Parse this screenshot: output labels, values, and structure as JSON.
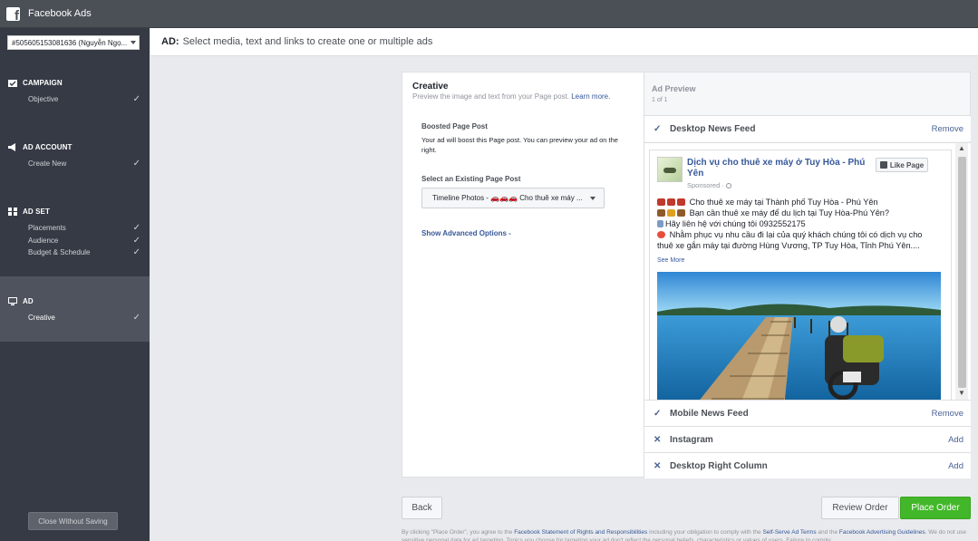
{
  "app": {
    "title": "Facebook Ads"
  },
  "sidebar": {
    "account_label": "#505605153081636 (Nguyễn Ngọ...",
    "sections": [
      {
        "title": "CAMPAIGN",
        "items": [
          {
            "label": "Objective"
          }
        ]
      },
      {
        "title": "AD ACCOUNT",
        "items": [
          {
            "label": "Create New"
          }
        ]
      },
      {
        "title": "AD SET",
        "items": [
          {
            "label": "Placements"
          },
          {
            "label": "Audience"
          },
          {
            "label": "Budget & Schedule"
          }
        ]
      },
      {
        "title": "AD",
        "items": [
          {
            "label": "Creative"
          }
        ]
      }
    ],
    "close_label": "Close Without Saving"
  },
  "header": {
    "prefix": "AD:",
    "text": "Select media, text and links to create one or multiple ads"
  },
  "creative": {
    "title": "Creative",
    "subtitle": "Preview the image and text from your Page post.",
    "learn_more": "Learn more.",
    "boosted_label": "Boosted Page Post",
    "boosted_desc": "Your ad will boost this Page post. You can preview your ad on the right.",
    "select_label": "Select an Existing Page Post",
    "select_value": "Timeline Photos - 🚗🚗🚗 Cho thuê xe máy ...",
    "advanced_link": "Show Advanced Options -"
  },
  "preview": {
    "title": "Ad Preview",
    "count": "1 of 1",
    "placements": [
      {
        "label": "Desktop News Feed",
        "action": "Remove",
        "selected": true
      },
      {
        "label": "Mobile News Feed",
        "action": "Remove",
        "selected": true
      },
      {
        "label": "Instagram",
        "action": "Add",
        "selected": false
      },
      {
        "label": "Desktop Right Column",
        "action": "Add",
        "selected": false
      }
    ],
    "post": {
      "page_name": "Dịch vụ cho thuê xe máy ở Tuy Hòa - Phú Yên",
      "sponsored": "Sponsored · ",
      "like_label": "Like Page",
      "lines": [
        "Cho thuê xe máy tại Thành phố Tuy Hòa - Phú Yên",
        "Bạn cần thuê xe máy để du lịch tại Tuy Hòa-Phú Yên?",
        "Hãy liên hệ với chúng tôi 0932552175",
        "Nhằm phục vụ nhu cầu đi lại của quý khách chúng tôi có dịch vụ cho",
        "thuê xe gắn máy tại đường Hùng Vương, TP Tuy Hòa, Tỉnh Phú Yên...."
      ],
      "see_more": "See More"
    }
  },
  "buttons": {
    "back": "Back",
    "review": "Review Order",
    "place": "Place Order"
  },
  "footer": {
    "t1": "By clicking \"Place Order\", you agree to the ",
    "l1": "Facebook Statement of Rights and Responsibilities",
    "t2": " including your obligation to comply with the ",
    "l2": "Self-Serve Ad Terms",
    "t3": " and the ",
    "l3": "Facebook Advertising Guidelines",
    "t4": ". We do not use sensitive personal data for ad targeting. Topics you choose for targeting your ad don't reflect the personal beliefs, characteristics or values of users. Failure to comply"
  },
  "colors": {
    "sidebar": "#353a44",
    "topbar": "#4b4f56",
    "link": "#365899",
    "place_order": "#42b72a"
  }
}
